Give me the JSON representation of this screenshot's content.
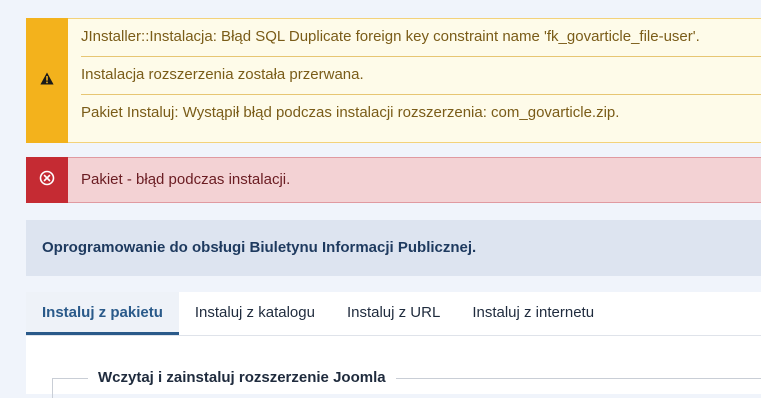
{
  "alerts": {
    "warning": {
      "icon": "warning-icon",
      "color": "#f3b21c",
      "messages": [
        "JInstaller::Instalacja: Błąd SQL Duplicate foreign key constraint name 'fk_govarticle_file-user'.",
        "Instalacja rozszerzenia została przerwana.",
        "Pakiet Instaluj: Wystąpił błąd podczas instalacji rozszerzenia: com_govarticle.zip."
      ]
    },
    "error": {
      "icon": "circle-x-icon",
      "color": "#c52b33",
      "message": "Pakiet - błąd podczas instalacji."
    }
  },
  "info": {
    "text": "Oprogramowanie do obsługi Biuletynu Informacji Publicznej."
  },
  "tabs": [
    {
      "label": "Instaluj z pakietu",
      "active": true
    },
    {
      "label": "Instaluj z katalogu",
      "active": false
    },
    {
      "label": "Instaluj z URL",
      "active": false
    },
    {
      "label": "Instaluj z internetu",
      "active": false
    }
  ],
  "upload": {
    "legend": "Wczytaj i zainstaluj rozszerzenie Joomla"
  }
}
